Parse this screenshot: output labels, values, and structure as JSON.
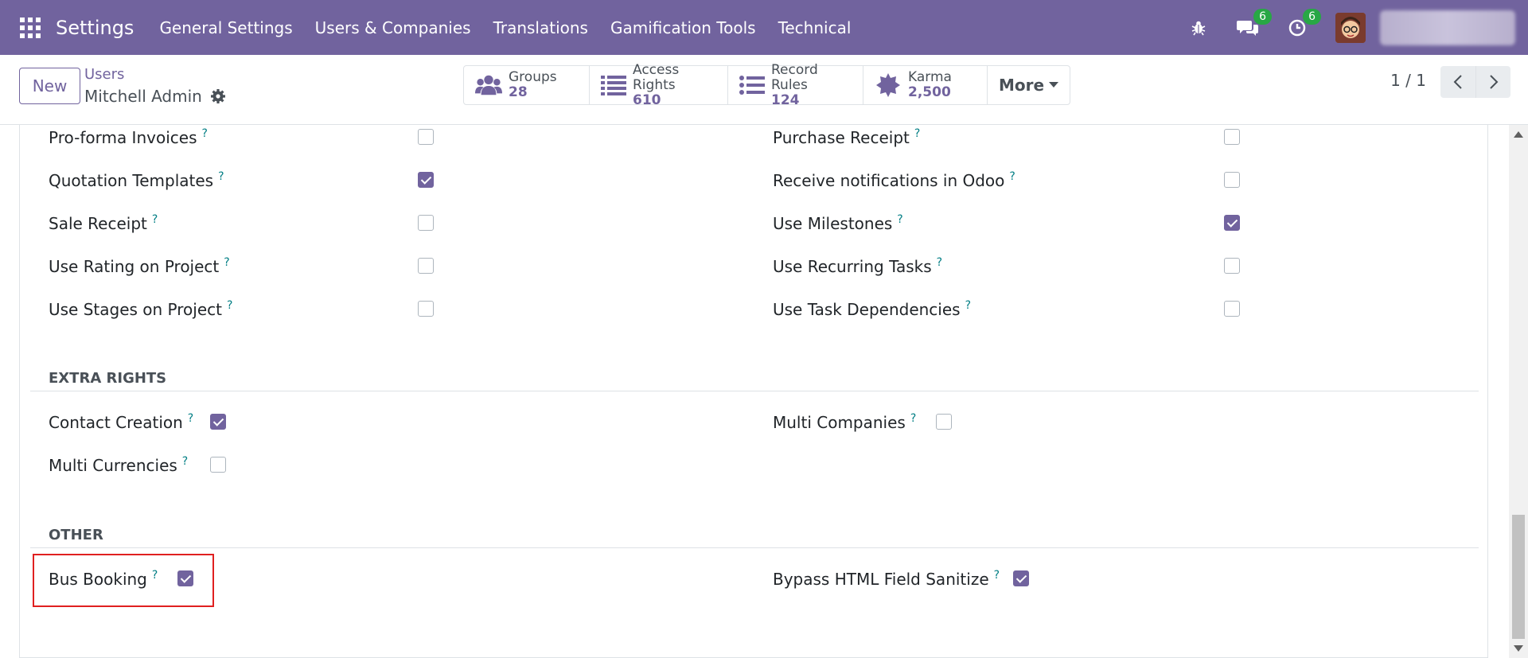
{
  "navbar": {
    "brand": "Settings",
    "menu": [
      "General Settings",
      "Users & Companies",
      "Translations",
      "Gamification Tools",
      "Technical"
    ],
    "messages_count": "6",
    "activities_count": "6",
    "color": "#71639e"
  },
  "control": {
    "new_label": "New",
    "breadcrumb": "Users",
    "record_name": "Mitchell Admin",
    "smart_buttons": [
      {
        "label": "Groups",
        "value": "28",
        "icon": "users-icon"
      },
      {
        "label": "Access Rights",
        "value": "610",
        "icon": "list-icon"
      },
      {
        "label": "Record Rules",
        "value": "124",
        "icon": "list-icon"
      },
      {
        "label": "Karma",
        "value": "2,500",
        "icon": "karma-badge-icon"
      }
    ],
    "more_label": "More",
    "pager": "1 / 1"
  },
  "rights": {
    "left": [
      {
        "label": "Pro-forma Invoices",
        "checked": false
      },
      {
        "label": "Quotation Templates",
        "checked": true
      },
      {
        "label": "Sale Receipt",
        "checked": false
      },
      {
        "label": "Use Rating on Project",
        "checked": false
      },
      {
        "label": "Use Stages on Project",
        "checked": false
      }
    ],
    "right": [
      {
        "label": "Purchase Receipt",
        "checked": false
      },
      {
        "label": "Receive notifications in Odoo",
        "checked": false
      },
      {
        "label": "Use Milestones",
        "checked": true
      },
      {
        "label": "Use Recurring Tasks",
        "checked": false
      },
      {
        "label": "Use Task Dependencies",
        "checked": false
      }
    ]
  },
  "extra_rights": {
    "title": "EXTRA RIGHTS",
    "items": [
      {
        "label": "Contact Creation",
        "checked": true
      },
      {
        "label": "Multi Companies",
        "checked": false
      },
      {
        "label": "Multi Currencies",
        "checked": false
      }
    ]
  },
  "other": {
    "title": "OTHER",
    "items": [
      {
        "label": "Bus Booking",
        "checked": true
      },
      {
        "label": "Bypass HTML Field Sanitize",
        "checked": true
      }
    ]
  },
  "help_mark": "?",
  "highlight_color": "#e02020"
}
